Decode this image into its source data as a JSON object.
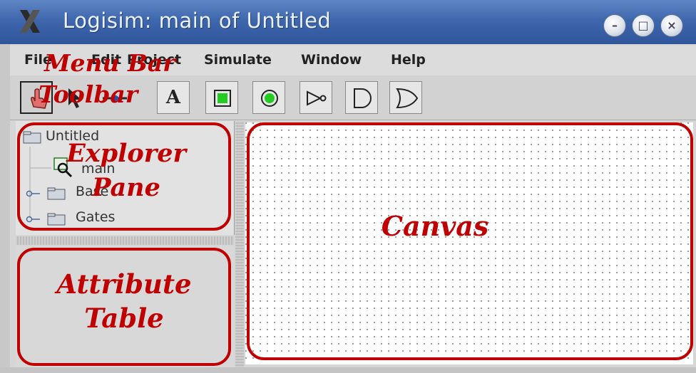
{
  "window": {
    "title": "Logisim: main of Untitled",
    "controls": [
      "minimize-icon",
      "maximize-icon",
      "close-icon"
    ],
    "close_glyph": "×",
    "minimize_glyph": "–",
    "maximize_glyph": "□"
  },
  "menubar": {
    "items": [
      {
        "label": "File"
      },
      {
        "label": "Edit"
      },
      {
        "label": "Project"
      },
      {
        "label": "Simulate"
      },
      {
        "label": "Window"
      },
      {
        "label": "Help"
      }
    ]
  },
  "toolbar": {
    "tools": [
      {
        "icon": "hand-poke-icon",
        "selected": true
      },
      {
        "icon": "arrow-select-icon",
        "selected": false
      },
      {
        "icon": "wiring-icon",
        "selected": false
      },
      {
        "icon": "text-tool-icon",
        "glyph": "A",
        "selected": false
      },
      {
        "icon": "input-pin-icon",
        "selected": false
      },
      {
        "icon": "output-pin-icon",
        "selected": false
      },
      {
        "icon": "not-gate-icon",
        "selected": false
      },
      {
        "icon": "and-gate-icon",
        "selected": false
      },
      {
        "icon": "or-gate-icon",
        "selected": false
      }
    ]
  },
  "explorer": {
    "items": [
      {
        "label": "Untitled",
        "icon": "folder-icon"
      },
      {
        "label": "main",
        "icon": "circuit-magnifier-icon"
      },
      {
        "label": "Base",
        "icon": "folder-icon"
      },
      {
        "label": "Gates",
        "icon": "folder-icon"
      }
    ]
  },
  "annotations": {
    "menu_bar": "Menu Bar",
    "toolbar": "Toolbar",
    "explorer_pane_1": "Explorer",
    "explorer_pane_2": "Pane",
    "attribute_table_1": "Attribute",
    "attribute_table_2": "Table",
    "canvas": "Canvas"
  },
  "colors": {
    "annotation": "#c00000",
    "titlebar": "#3f67ad",
    "canvas_bg": "#ffffff"
  }
}
